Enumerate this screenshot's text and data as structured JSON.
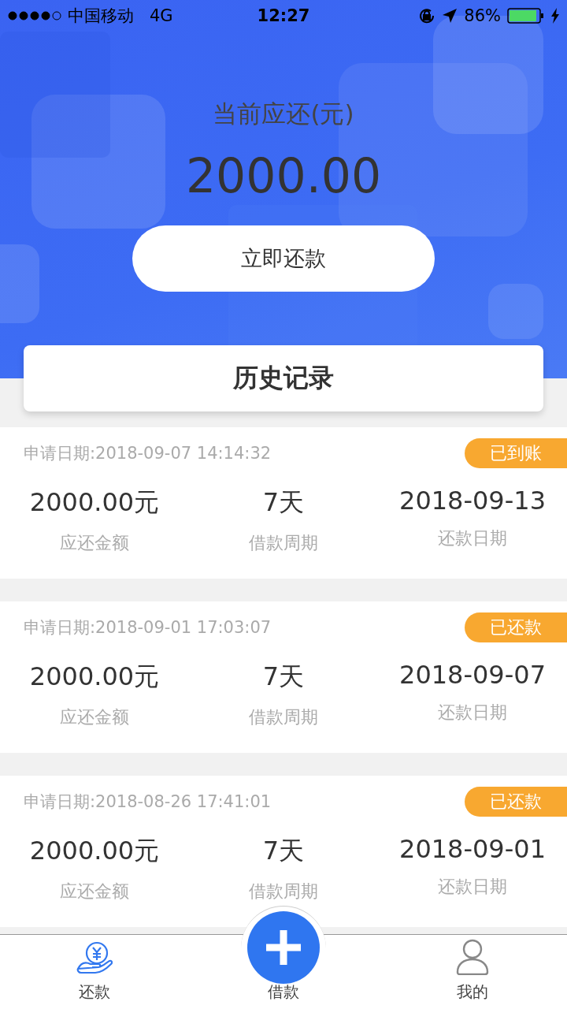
{
  "status_bar": {
    "carrier": "中国移动",
    "network": "4G",
    "time": "12:27",
    "battery": "86%"
  },
  "header": {
    "title": "当前应还(元)",
    "amount": "2000.00",
    "button": "立即还款"
  },
  "history_title": "历史记录",
  "records": [
    {
      "applied": "申请日期:2018-09-07 14:14:32",
      "status": "已到账",
      "amount": "2000.00元",
      "amount_label": "应还金额",
      "period": "7天",
      "period_label": "借款周期",
      "due": "2018-09-13",
      "due_label": "还款日期"
    },
    {
      "applied": "申请日期:2018-09-01 17:03:07",
      "status": "已还款",
      "amount": "2000.00元",
      "amount_label": "应还金额",
      "period": "7天",
      "period_label": "借款周期",
      "due": "2018-09-07",
      "due_label": "还款日期"
    },
    {
      "applied": "申请日期:2018-08-26 17:41:01",
      "status": "已还款",
      "amount": "2000.00元",
      "amount_label": "应还金额",
      "period": "7天",
      "period_label": "借款周期",
      "due": "2018-09-01",
      "due_label": "还款日期"
    }
  ],
  "tab_bar": [
    {
      "kind": "repay",
      "label": "还款",
      "selected": true
    },
    {
      "kind": "borrow",
      "label": "借款",
      "selected": false
    },
    {
      "kind": "profile",
      "label": "我的",
      "selected": false
    }
  ]
}
